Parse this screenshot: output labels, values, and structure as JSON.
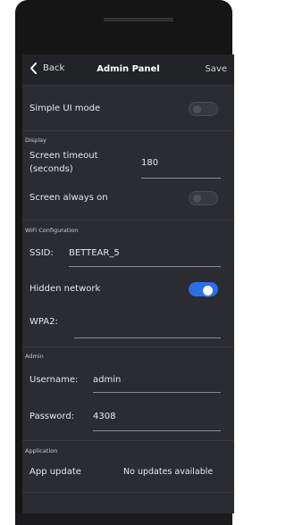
{
  "header": {
    "back_label": "Back",
    "title": "Admin Panel",
    "save_label": "Save"
  },
  "simple_ui": {
    "label": "Simple UI mode",
    "enabled": false
  },
  "display": {
    "section_title": "Display",
    "timeout_label_line1": "Screen timeout",
    "timeout_label_line2": "(seconds)",
    "timeout_value": "180",
    "always_on_label": "Screen always on",
    "always_on_enabled": false
  },
  "wifi": {
    "section_title": "WiFi Configuration",
    "ssid_label": "SSID:",
    "ssid_value": "BETTEAR_5",
    "hidden_label": "Hidden network",
    "hidden_enabled": true,
    "wpa_label": "WPA2:",
    "wpa_value": ""
  },
  "admin": {
    "section_title": "Admin",
    "username_label": "Username:",
    "username_value": "admin",
    "password_label": "Password:",
    "password_value": "4308"
  },
  "application": {
    "section_title": "Application",
    "update_label": "App update",
    "update_status": "No updates available"
  }
}
